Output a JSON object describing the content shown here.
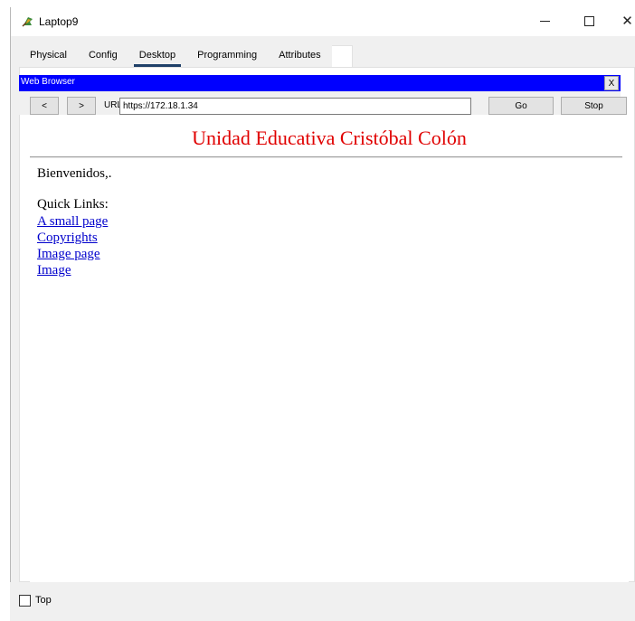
{
  "window": {
    "title": "Laptop9",
    "minimize_label": "",
    "close_label": "✕"
  },
  "tabs": [
    {
      "label": "Physical",
      "active": false
    },
    {
      "label": "Config",
      "active": false
    },
    {
      "label": "Desktop",
      "active": true
    },
    {
      "label": "Programming",
      "active": false
    },
    {
      "label": "Attributes",
      "active": false
    }
  ],
  "browser": {
    "title": "Web Browser",
    "close_label": "X",
    "back_label": "<",
    "forward_label": ">",
    "url_label": "URL",
    "url_value": "https://172.18.1.34",
    "go_label": "Go",
    "stop_label": "Stop"
  },
  "webpage": {
    "heading": "Unidad Educativa Cristóbal Colón",
    "greeting": "Bienvenidos,.",
    "quick_links_title": "Quick Links:",
    "links": [
      {
        "label": "A small page"
      },
      {
        "label": "Copyrights"
      },
      {
        "label": "Image page"
      },
      {
        "label": "Image"
      }
    ]
  },
  "footer": {
    "top_checkbox_label": "Top",
    "top_checked": false
  },
  "colors": {
    "browser_titlebar": "#0000ff",
    "heading": "#e00000",
    "link": "#0000cc",
    "active_tab_underline": "#1f4068"
  },
  "icons": {
    "app": "laptop-app-icon",
    "minimize": "minimize-icon",
    "maximize": "maximize-icon",
    "close": "close-icon"
  }
}
